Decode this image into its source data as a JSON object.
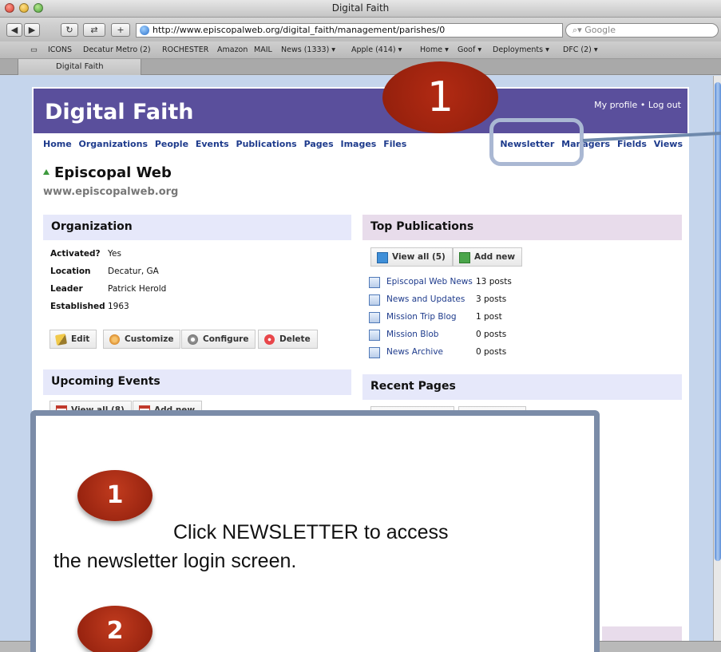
{
  "browser": {
    "window_title": "Digital Faith",
    "url": "http://www.episcopalweb.org/digital_faith/management/parishes/0",
    "search_placeholder": "Google",
    "bookmarks": [
      "ICONS",
      "Decatur Metro (2)",
      "ROCHESTER",
      "Amazon",
      "MAIL",
      "News (1333) ▾",
      "Apple (414) ▾",
      "Home ▾",
      "Goof ▾",
      "Deployments ▾",
      "DFC (2) ▾"
    ],
    "tab_label": "Digital Faith"
  },
  "header": {
    "site_title": "Digital Faith",
    "my_profile": "My profile",
    "separator": "•",
    "log_out": "Log out"
  },
  "nav": {
    "left": [
      "Home",
      "Organizations",
      "People",
      "Events",
      "Publications",
      "Pages",
      "Images",
      "Files"
    ],
    "right": [
      "Newsletter",
      "Managers",
      "Fields",
      "Views"
    ]
  },
  "org": {
    "title": "Episcopal Web",
    "domain": "www.episcopalweb.org"
  },
  "organization_panel": {
    "heading": "Organization",
    "rows": [
      {
        "label": "Activated?",
        "value": "Yes"
      },
      {
        "label": "Location",
        "value": "Decatur, GA"
      },
      {
        "label": "Leader",
        "value": "Patrick Herold"
      },
      {
        "label": "Established",
        "value": "1963"
      }
    ],
    "buttons": [
      "Edit",
      "Customize",
      "Configure",
      "Delete"
    ]
  },
  "events_panel": {
    "heading": "Upcoming Events",
    "buttons": [
      "View all (8)",
      "Add new"
    ]
  },
  "publications_panel": {
    "heading": "Top Publications",
    "buttons": [
      "View all (5)",
      "Add new"
    ],
    "items": [
      {
        "name": "Episcopal Web News",
        "count": "13 posts"
      },
      {
        "name": "News and Updates",
        "count": "3 posts"
      },
      {
        "name": "Mission Trip Blog",
        "count": "1 post"
      },
      {
        "name": "Mission Blob",
        "count": "0 posts"
      },
      {
        "name": "News Archive",
        "count": "0 posts"
      }
    ]
  },
  "pages_panel": {
    "heading": "Recent Pages"
  },
  "annotation": {
    "big_badge": "1",
    "step1_badge": "1",
    "step1_text_line1": "Click NEWSLETTER to access",
    "step1_text_line2": "the newsletter login screen.",
    "step2_badge": "2"
  },
  "colors": {
    "header_bg": "#5a4f9c",
    "nav_link": "#1e3b8c",
    "badge_red": "#a3240f",
    "panel_blue": "#e6e8fa",
    "panel_purple": "#e8dceb"
  }
}
